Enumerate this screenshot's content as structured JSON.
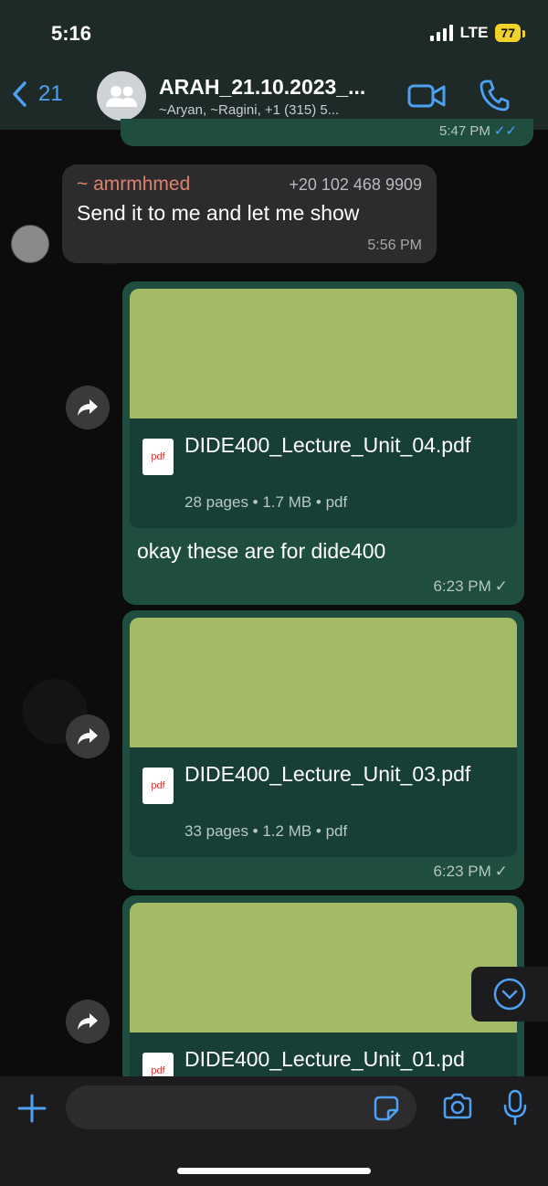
{
  "status_bar": {
    "time": "5:16",
    "network": "LTE",
    "battery": "77"
  },
  "header": {
    "back_count": "21",
    "title": "ARAH_21.10.2023_...",
    "subtitle": "~Aryan, ~Ragini, +1 (315) 5...",
    "icons": [
      "video-call-icon",
      "phone-icon"
    ]
  },
  "messages": {
    "previous": {
      "time": "5:47 PM"
    },
    "incoming": {
      "sender": "~ amrmhmed",
      "phone": "+20 102 468 9909",
      "text": "Send it to me and let me show",
      "time": "5:56 PM"
    },
    "docs": [
      {
        "icon_label": "pdf",
        "name": "DIDE400_Lecture_Unit_04.pdf",
        "meta": "28 pages • 1.7 MB • pdf",
        "caption": "okay these are for dide400",
        "time": "6:23 PM"
      },
      {
        "icon_label": "pdf",
        "name": "DIDE400_Lecture_Unit_03.pdf",
        "meta": "33 pages • 1.2 MB • pdf",
        "time": "6:23 PM"
      },
      {
        "icon_label": "pdf",
        "name": "DIDE400_Lecture_Unit_01.pd"
      }
    ]
  },
  "composer": {
    "placeholder": ""
  },
  "colors": {
    "accent": "#4ea0f2",
    "outgoing_bubble": "#1f4d40",
    "doc_thumbnail": "#a3bb67",
    "sender_name": "#e0826b"
  }
}
